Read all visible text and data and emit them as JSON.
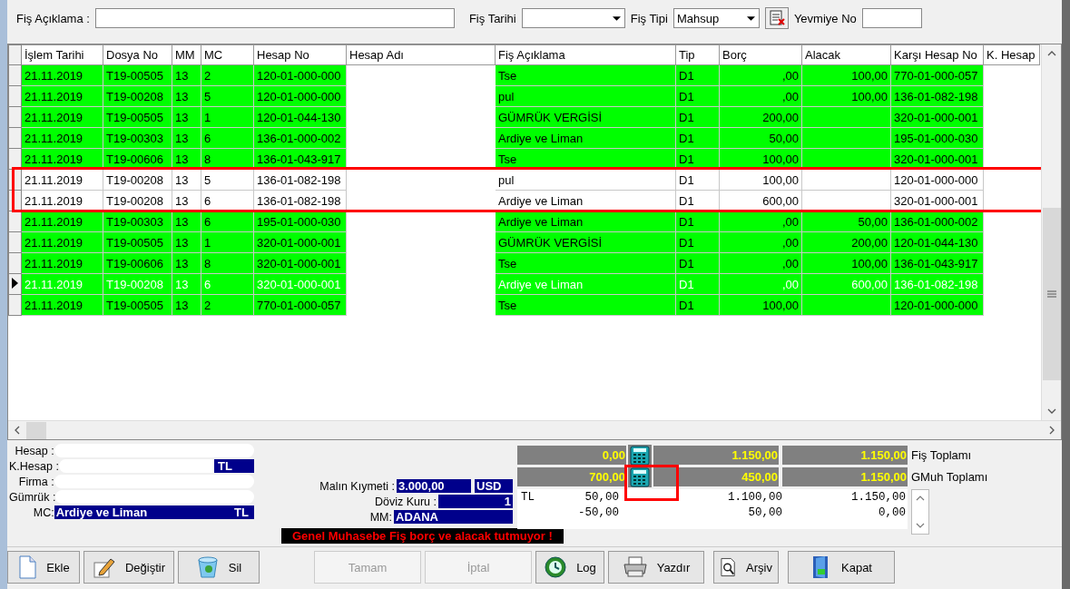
{
  "filter": {
    "description_label": "Fiş Açıklama :",
    "date_label": "Fiş Tarihi",
    "type_label": "Fiş  Tipi",
    "type_value": "Mahsup",
    "journal_label": "Yevmiye No"
  },
  "table": {
    "columns": [
      "İşlem Tarihi",
      "Dosya No",
      "MM",
      "MC",
      "Hesap No",
      "Hesap Adı",
      "Fiş Açıklama",
      "Tip",
      "Borç",
      "Alacak",
      "Karşı Hesap No",
      "K. Hesap"
    ],
    "rows": [
      {
        "date": "21.11.2019",
        "file_no": "T19-00505",
        "mm": "13",
        "mc": "2",
        "account_no": "120-01-000-000",
        "description": "Tse",
        "type": "D1",
        "debit": ",00",
        "credit": "100,00",
        "counter_account": "770-01-000-057",
        "highlighted": true,
        "selected": false
      },
      {
        "date": "21.11.2019",
        "file_no": "T19-00208",
        "mm": "13",
        "mc": "5",
        "account_no": "120-01-000-000",
        "description": "pul",
        "type": "D1",
        "debit": ",00",
        "credit": "100,00",
        "counter_account": "136-01-082-198",
        "highlighted": true,
        "selected": false
      },
      {
        "date": "21.11.2019",
        "file_no": "T19-00505",
        "mm": "13",
        "mc": "1",
        "account_no": "120-01-044-130",
        "description": "GÜMRÜK VERGİSİ",
        "type": "D1",
        "debit": "200,00",
        "counter_account": "320-01-000-001",
        "highlighted": true,
        "selected": false
      },
      {
        "date": "21.11.2019",
        "file_no": "T19-00303",
        "mm": "13",
        "mc": "6",
        "account_no": "136-01-000-002",
        "description": "Ardiye ve Liman",
        "type": "D1",
        "debit": "50,00",
        "counter_account": "195-01-000-030",
        "highlighted": true,
        "selected": false
      },
      {
        "date": "21.11.2019",
        "file_no": "T19-00606",
        "mm": "13",
        "mc": "8",
        "account_no": "136-01-043-917",
        "description": "Tse",
        "type": "D1",
        "debit": "100,00",
        "counter_account": "320-01-000-001",
        "highlighted": true,
        "selected": false
      },
      {
        "date": "21.11.2019",
        "file_no": "T19-00208",
        "mm": "13",
        "mc": "5",
        "account_no": "136-01-082-198",
        "description": "pul",
        "type": "D1",
        "debit": "100,00",
        "counter_account": "120-01-000-000",
        "highlighted": false,
        "selected": false
      },
      {
        "date": "21.11.2019",
        "file_no": "T19-00208",
        "mm": "13",
        "mc": "6",
        "account_no": "136-01-082-198",
        "description": "Ardiye ve Liman",
        "type": "D1",
        "debit": "600,00",
        "counter_account": "320-01-000-001",
        "highlighted": false,
        "selected": false
      },
      {
        "date": "21.11.2019",
        "file_no": "T19-00303",
        "mm": "13",
        "mc": "6",
        "account_no": "195-01-000-030",
        "description": "Ardiye ve Liman",
        "type": "D1",
        "debit": ",00",
        "credit": "50,00",
        "counter_account": "136-01-000-002",
        "highlighted": true,
        "selected": false
      },
      {
        "date": "21.11.2019",
        "file_no": "T19-00505",
        "mm": "13",
        "mc": "1",
        "account_no": "320-01-000-001",
        "description": "GÜMRÜK VERGİSİ",
        "type": "D1",
        "debit": ",00",
        "credit": "200,00",
        "counter_account": "120-01-044-130",
        "highlighted": true,
        "selected": false
      },
      {
        "date": "21.11.2019",
        "file_no": "T19-00606",
        "mm": "13",
        "mc": "8",
        "account_no": "320-01-000-001",
        "description": "Tse",
        "type": "D1",
        "debit": ",00",
        "credit": "100,00",
        "counter_account": "136-01-043-917",
        "highlighted": true,
        "selected": false
      },
      {
        "date": "21.11.2019",
        "file_no": "T19-00208",
        "mm": "13",
        "mc": "6",
        "account_no": "320-01-000-001",
        "description": "Ardiye ve Liman",
        "type": "D1",
        "debit": ",00",
        "credit": "600,00",
        "counter_account": "136-01-082-198",
        "highlighted": true,
        "selected": true
      },
      {
        "date": "21.11.2019",
        "file_no": "T19-00505",
        "mm": "13",
        "mc": "2",
        "account_no": "770-01-000-057",
        "description": "Tse",
        "type": "D1",
        "debit": "100,00",
        "counter_account": "120-01-000-000",
        "highlighted": true,
        "selected": false
      }
    ]
  },
  "details": {
    "fields": [
      {
        "label": "Hesap :",
        "redacted": true
      },
      {
        "label": "K.Hesap :",
        "redacted": true,
        "currency": "TL"
      },
      {
        "label": "Firma :",
        "redacted": true
      },
      {
        "label": "Gümrük :",
        "redacted": true
      },
      {
        "label": "MC:",
        "value": "Ardiye ve Liman",
        "currency": "TL",
        "redacted": false
      }
    ],
    "goods_value_label": "Malın Kıymeti :",
    "goods_value": "3.000,00",
    "goods_currency": "USD",
    "rate_label": "Döviz Kuru :",
    "rate": "1",
    "mm_label": "MM:",
    "mm": "ADANA"
  },
  "totals": [
    {
      "values": [
        "0,00",
        "1.150,00",
        "1.150,00"
      ],
      "label": "Fiş Toplamı"
    },
    {
      "values": [
        "700,00",
        "450,00",
        "1.150,00"
      ],
      "label": "GMuh Toplamı"
    }
  ],
  "balance_lines": [
    {
      "currency": "TL",
      "values": [
        "50,00",
        "1.100,00",
        "1.150,00"
      ]
    },
    {
      "values": [
        "-50,00",
        "50,00",
        "0,00"
      ]
    }
  ],
  "error_message": "Genel Muhasebe Fiş borç ve alacak tutmuyor !",
  "buttons": [
    {
      "label": "Ekle",
      "kind": "page",
      "disabled": false
    },
    {
      "label": "Değiştir",
      "kind": "pencil",
      "disabled": false
    },
    {
      "label": "Sil",
      "kind": "bin",
      "disabled": false
    },
    {
      "label": "Tamam",
      "kind": "plain",
      "disabled": true
    },
    {
      "label": "İptal",
      "kind": "plain",
      "disabled": true
    },
    {
      "label": "Log",
      "kind": "log",
      "disabled": false
    },
    {
      "label": "Yazdır",
      "kind": "printer",
      "disabled": false
    },
    {
      "label": "Arşiv",
      "kind": "magnifier",
      "disabled": false
    },
    {
      "label": "Kapat",
      "kind": "door",
      "disabled": false
    }
  ]
}
